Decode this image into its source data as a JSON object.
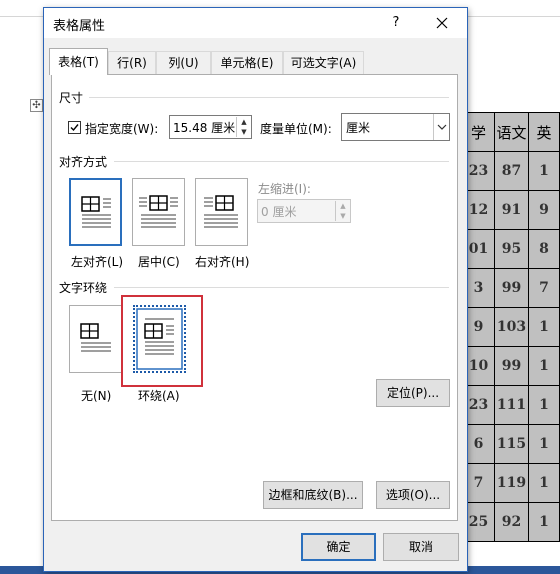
{
  "document": {
    "table_header": [
      "学",
      "语文",
      "英"
    ],
    "table_rows": [
      [
        "23",
        "87",
        "1"
      ],
      [
        "12",
        "91",
        "9"
      ],
      [
        "01",
        "95",
        "8"
      ],
      [
        "3",
        "99",
        "7"
      ],
      [
        "9",
        "103",
        "1"
      ],
      [
        "10",
        "99",
        "1"
      ],
      [
        "23",
        "111",
        "1"
      ],
      [
        "6",
        "115",
        "1"
      ],
      [
        "7",
        "119",
        "1"
      ],
      [
        "25",
        "92",
        "1"
      ]
    ]
  },
  "dialog": {
    "title": "表格属性",
    "help_label": "?",
    "tabs": [
      {
        "label": "表格(T)",
        "active": true
      },
      {
        "label": "行(R)",
        "active": false
      },
      {
        "label": "列(U)",
        "active": false
      },
      {
        "label": "单元格(E)",
        "active": false
      },
      {
        "label": "可选文字(A)",
        "active": false
      }
    ],
    "size": {
      "heading": "尺寸",
      "width_checkbox_label": "指定宽度(W):",
      "width_checked": true,
      "width_value": "15.48 厘米",
      "unit_label": "度量单位(M):",
      "unit_value": "厘米"
    },
    "alignment": {
      "heading": "对齐方式",
      "options": [
        "左对齐(L)",
        "居中(C)",
        "右对齐(H)"
      ],
      "selected": "左对齐(L)",
      "indent_label": "左缩进(I):",
      "indent_value": "0 厘米"
    },
    "wrapping": {
      "heading": "文字环绕",
      "options": [
        "无(N)",
        "环绕(A)"
      ],
      "selected": "环绕(A)"
    },
    "buttons": {
      "position": "定位(P)...",
      "borders": "边框和底纹(B)...",
      "options": "选项(O)...",
      "ok": "确定",
      "cancel": "取消"
    }
  },
  "colors": {
    "accent": "#2a6fbd",
    "highlight": "#d0313b",
    "table_fill": "#c0c0c0"
  }
}
